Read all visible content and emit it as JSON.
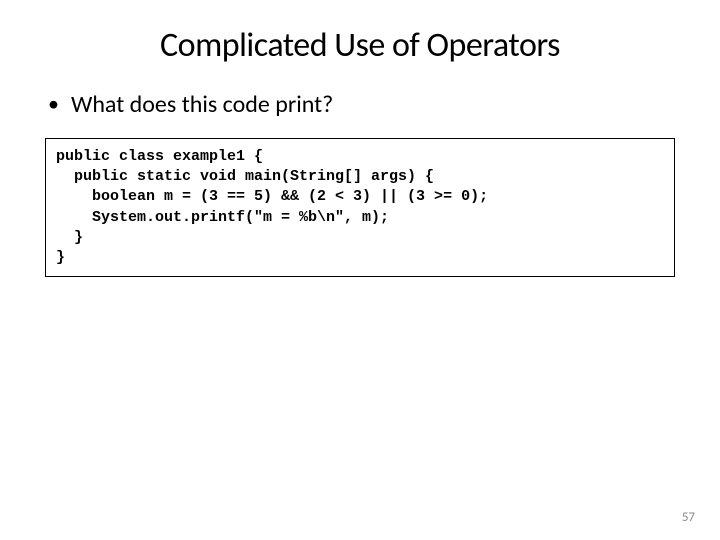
{
  "title": "Complicated Use of Operators",
  "bullet": "What does this code print?",
  "code": {
    "line1": "public class example1 {",
    "line2": "  public static void main(String[] args) {",
    "line3": "    boolean m = (3 == 5) && (2 < 3) || (3 >= 0);",
    "line4": "    System.out.printf(\"m = %b\\n\", m);",
    "line5": "  }",
    "line6": "}"
  },
  "pageNumber": "57"
}
